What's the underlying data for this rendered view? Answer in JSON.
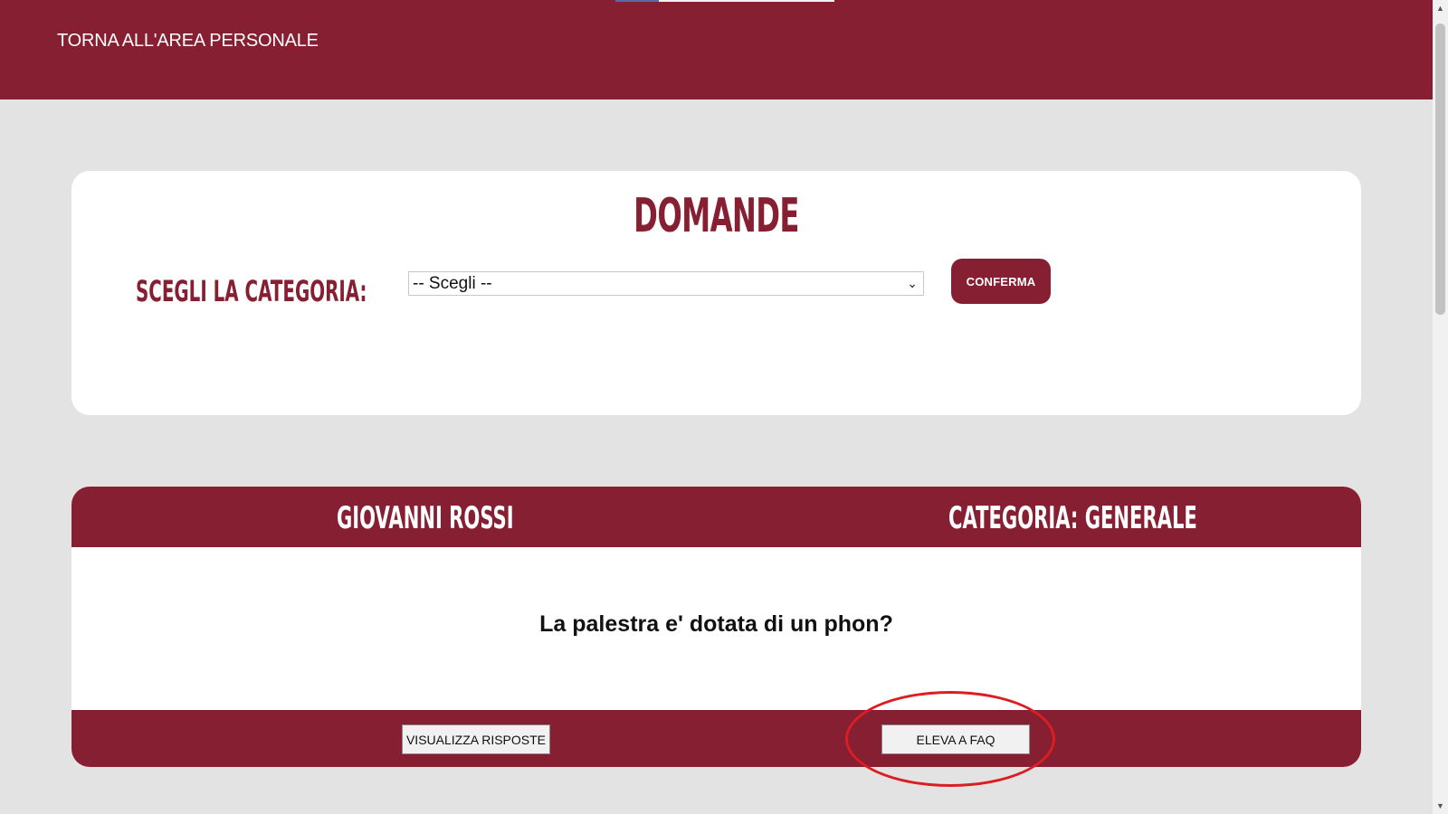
{
  "header": {
    "back_link": "TORNA ALL'AREA PERSONALE"
  },
  "filter_panel": {
    "title": "DOMANDE",
    "category_label": "SCEGLI LA CATEGORIA:",
    "select_value": "-- Scegli --",
    "confirm_label": "CONFERMA"
  },
  "question_card": {
    "author": "GIOVANNI ROSSI",
    "category": "CATEGORIA: GENERALE",
    "question": "La palestra e' dotata di un phon?",
    "view_answers_label": "VISUALIZZA RISPOSTE",
    "elevate_faq_label": "ELEVA A FAQ"
  },
  "colors": {
    "brand": "#871f32",
    "background": "#e3e3e3",
    "highlight": "#dd1d24"
  },
  "icons": {
    "select_chevron": "chevron-down-icon",
    "scroll_up": "triangle-up-icon",
    "scroll_down": "triangle-down-icon"
  }
}
